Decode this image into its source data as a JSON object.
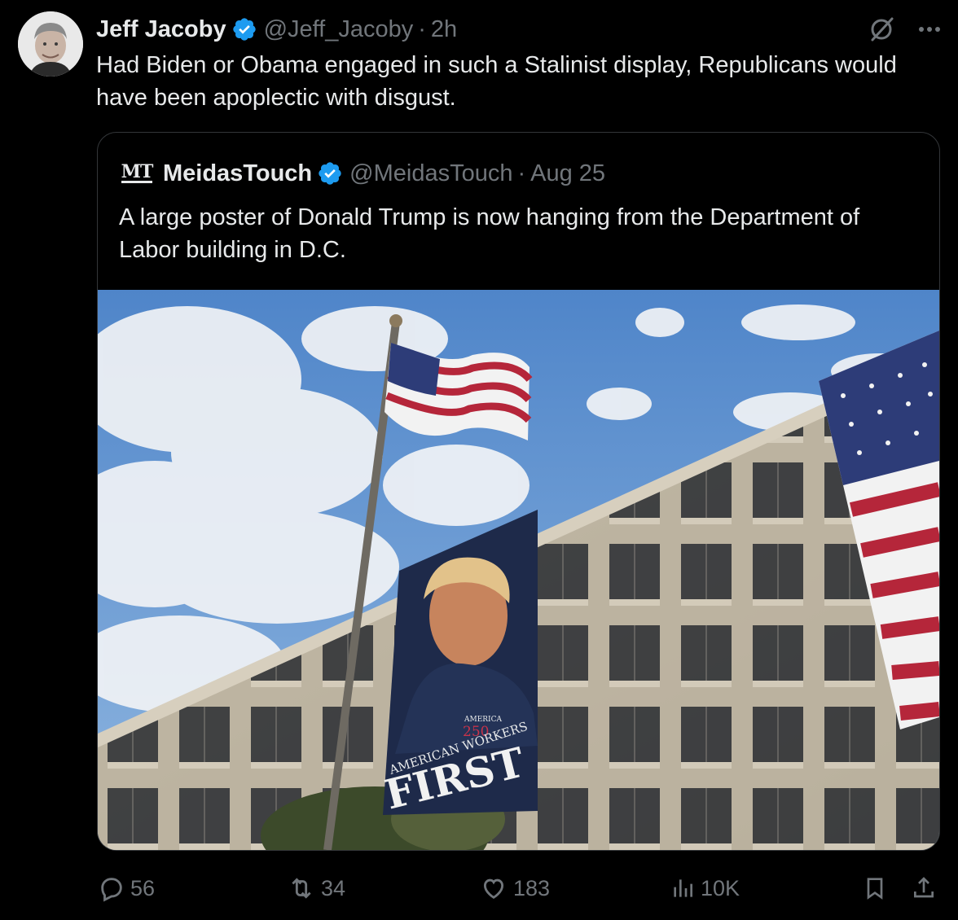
{
  "tweet": {
    "author_name": "Jeff Jacoby",
    "handle": "@Jeff_Jacoby",
    "time": "2h",
    "separator": "·",
    "text": "Had Biden or Obama engaged in such a Stalinist display, Republicans would have been apoplectic with disgust."
  },
  "quoted": {
    "logo_text": "MT",
    "author_name": "MeidasTouch",
    "handle": "@MeidasTouch",
    "separator": "·",
    "time": "Aug 25",
    "text": "A large poster of Donald Trump is now hanging from the Department of Labor building in D.C.",
    "image": {
      "banner_small": "AMERICA",
      "banner_number": "250",
      "banner_line1": "AMERICAN WORKERS",
      "banner_line2": "FIRST"
    }
  },
  "actions": {
    "replies": "56",
    "reposts": "34",
    "likes": "183",
    "views": "10K"
  },
  "colors": {
    "background": "#000000",
    "text": "#e7e9ea",
    "muted": "#71767b",
    "verified": "#1d9bf0",
    "border": "#333639"
  },
  "icons": [
    "verified-badge-icon",
    "grok-icon",
    "more-icon",
    "reply-icon",
    "repost-icon",
    "like-icon",
    "views-icon",
    "bookmark-icon",
    "share-icon"
  ]
}
